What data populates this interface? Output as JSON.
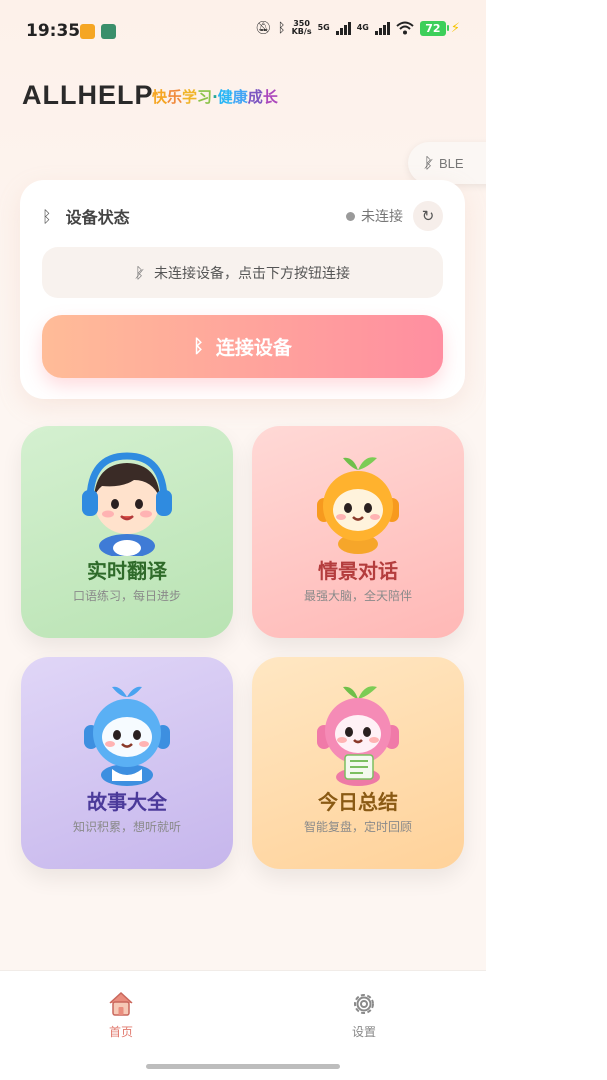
{
  "status_bar": {
    "time": "19:35",
    "speed_value": "350",
    "speed_unit": "KB/s",
    "net1": "5G",
    "net2": "4G",
    "battery": "72"
  },
  "header": {
    "brand": "ALLHELP",
    "slogan_chars": [
      "快",
      "乐",
      "学",
      "习",
      "·",
      "健",
      "康",
      "成",
      "长"
    ],
    "slogan_colors": [
      "#f5a623",
      "#f08a3c",
      "#f0b429",
      "#8bc34a",
      "#26a69a",
      "#29b6f6",
      "#42a5f5",
      "#7e57c2",
      "#ab47bc"
    ],
    "ble_label": "BLE"
  },
  "device_card": {
    "title": "设备状态",
    "status": "未连接",
    "hint": "未连接设备，点击下方按钮连接",
    "connect_label": "连接设备"
  },
  "features": [
    {
      "title": "实时翻译",
      "subtitle": "口语练习，每日进步",
      "mascot": "headphone-kid-mascot"
    },
    {
      "title": "情景对话",
      "subtitle": "最强大脑，全天陪伴",
      "mascot": "orange-sprout-mascot"
    },
    {
      "title": "故事大全",
      "subtitle": "知识积累，想听就听",
      "mascot": "blue-robot-mascot"
    },
    {
      "title": "今日总结",
      "subtitle": "智能复盘，定时回顾",
      "mascot": "pink-sprout-mascot"
    }
  ],
  "bottom_nav": {
    "home_label": "首页",
    "settings_label": "设置"
  },
  "colors": {
    "accent": "#ff8ea0",
    "accent_start": "#ffbc98",
    "nav_active": "#e17a6e"
  }
}
